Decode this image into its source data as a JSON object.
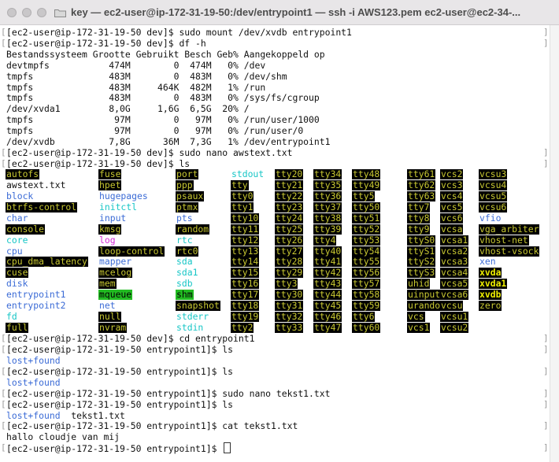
{
  "window": {
    "title": "key — ec2-user@ip-172-31-19-50:/dev/entrypoint1 — ssh -i AWS123.pem ec2-user@ec2-34-..."
  },
  "colors": {
    "dir_blue": "#3b6bd6",
    "cyan_link": "#17c6c6",
    "char_dev": "#c8c832",
    "char_dev_bg": "#000000",
    "block_dev": "#c8c832",
    "sticky_green_bg": "#22bb22",
    "magenta": "#d62ad6",
    "text": "#111111"
  },
  "lines_top": [
    "[ec2-user@ip-172-31-19-50 dev]$ sudo mount /dev/xvdb entrypoint1",
    "[ec2-user@ip-172-31-19-50 dev]$ df -h",
    "Bestandssysteem Grootte Gebruikt Besch Geb% Aangekoppeld op",
    "devtmpfs           474M        0  474M   0% /dev",
    "tmpfs              483M        0  483M   0% /dev/shm",
    "tmpfs              483M     464K  482M   1% /run",
    "tmpfs              483M        0  483M   0% /sys/fs/cgroup",
    "/dev/xvda1         8,0G     1,6G  6,5G  20% /",
    "tmpfs               97M        0   97M   0% /run/user/1000",
    "tmpfs               97M        0   97M   0% /run/user/0",
    "/dev/xvdb          7,8G      36M  7,3G   1% /dev/entrypoint1",
    "[ec2-user@ip-172-31-19-50 dev]$ sudo nano awstext.txt",
    "[ec2-user@ip-172-31-19-50 dev]$ ls"
  ],
  "ls_grid": [
    [
      {
        "t": "autofs",
        "s": "c"
      },
      {
        "t": "fuse",
        "s": "c"
      },
      {
        "t": "port",
        "s": "c"
      },
      {
        "t": "stdout",
        "s": "l"
      },
      {
        "t": "tty20",
        "s": "c"
      },
      {
        "t": "tty34",
        "s": "c"
      },
      {
        "t": "tty48",
        "s": "c"
      },
      {
        "t": "tty61",
        "s": "c"
      },
      {
        "t": "vcs2",
        "s": "c"
      },
      {
        "t": "vcsu3",
        "s": "c"
      }
    ],
    [
      {
        "t": "awstext.txt",
        "s": "p"
      },
      {
        "t": "hpet",
        "s": "c"
      },
      {
        "t": "ppp",
        "s": "c"
      },
      {
        "t": "tty",
        "s": "c"
      },
      {
        "t": "tty21",
        "s": "c"
      },
      {
        "t": "tty35",
        "s": "c"
      },
      {
        "t": "tty49",
        "s": "c"
      },
      {
        "t": "tty62",
        "s": "c"
      },
      {
        "t": "vcs3",
        "s": "c"
      },
      {
        "t": "vcsu4",
        "s": "c"
      }
    ],
    [
      {
        "t": "block",
        "s": "d"
      },
      {
        "t": "hugepages",
        "s": "d"
      },
      {
        "t": "psaux",
        "s": "c"
      },
      {
        "t": "tty0",
        "s": "c"
      },
      {
        "t": "tty22",
        "s": "c"
      },
      {
        "t": "tty36",
        "s": "c"
      },
      {
        "t": "tty5",
        "s": "c"
      },
      {
        "t": "tty63",
        "s": "c"
      },
      {
        "t": "vcs4",
        "s": "c"
      },
      {
        "t": "vcsu5",
        "s": "c"
      }
    ],
    [
      {
        "t": "btrfs-control",
        "s": "c"
      },
      {
        "t": "initctl",
        "s": "l"
      },
      {
        "t": "ptmx",
        "s": "c"
      },
      {
        "t": "tty1",
        "s": "c"
      },
      {
        "t": "tty23",
        "s": "c"
      },
      {
        "t": "tty37",
        "s": "c"
      },
      {
        "t": "tty50",
        "s": "c"
      },
      {
        "t": "tty7",
        "s": "c"
      },
      {
        "t": "vcs5",
        "s": "c"
      },
      {
        "t": "vcsu6",
        "s": "c"
      }
    ],
    [
      {
        "t": "char",
        "s": "d"
      },
      {
        "t": "input",
        "s": "d"
      },
      {
        "t": "pts",
        "s": "d"
      },
      {
        "t": "tty10",
        "s": "c"
      },
      {
        "t": "tty24",
        "s": "c"
      },
      {
        "t": "tty38",
        "s": "c"
      },
      {
        "t": "tty51",
        "s": "c"
      },
      {
        "t": "tty8",
        "s": "c"
      },
      {
        "t": "vcs6",
        "s": "c"
      },
      {
        "t": "vfio",
        "s": "d"
      }
    ],
    [
      {
        "t": "console",
        "s": "c"
      },
      {
        "t": "kmsg",
        "s": "c"
      },
      {
        "t": "random",
        "s": "c"
      },
      {
        "t": "tty11",
        "s": "c"
      },
      {
        "t": "tty25",
        "s": "c"
      },
      {
        "t": "tty39",
        "s": "c"
      },
      {
        "t": "tty52",
        "s": "c"
      },
      {
        "t": "tty9",
        "s": "c"
      },
      {
        "t": "vcsa",
        "s": "c"
      },
      {
        "t": "vga_arbiter",
        "s": "c"
      }
    ],
    [
      {
        "t": "core",
        "s": "l"
      },
      {
        "t": "log",
        "s": "m"
      },
      {
        "t": "rtc",
        "s": "l"
      },
      {
        "t": "tty12",
        "s": "c"
      },
      {
        "t": "tty26",
        "s": "c"
      },
      {
        "t": "tty4",
        "s": "c"
      },
      {
        "t": "tty53",
        "s": "c"
      },
      {
        "t": "ttyS0",
        "s": "c"
      },
      {
        "t": "vcsa1",
        "s": "c"
      },
      {
        "t": "vhost-net",
        "s": "c"
      }
    ],
    [
      {
        "t": "cpu",
        "s": "d"
      },
      {
        "t": "loop-control",
        "s": "c"
      },
      {
        "t": "rtc0",
        "s": "c"
      },
      {
        "t": "tty13",
        "s": "c"
      },
      {
        "t": "tty27",
        "s": "c"
      },
      {
        "t": "tty40",
        "s": "c"
      },
      {
        "t": "tty54",
        "s": "c"
      },
      {
        "t": "ttyS1",
        "s": "c"
      },
      {
        "t": "vcsa2",
        "s": "c"
      },
      {
        "t": "vhost-vsock",
        "s": "c"
      }
    ],
    [
      {
        "t": "cpu_dma_latency",
        "s": "c"
      },
      {
        "t": "mapper",
        "s": "d"
      },
      {
        "t": "sda",
        "s": "l"
      },
      {
        "t": "tty14",
        "s": "c"
      },
      {
        "t": "tty28",
        "s": "c"
      },
      {
        "t": "tty41",
        "s": "c"
      },
      {
        "t": "tty55",
        "s": "c"
      },
      {
        "t": "ttyS2",
        "s": "c"
      },
      {
        "t": "vcsa3",
        "s": "c"
      },
      {
        "t": "xen",
        "s": "d"
      }
    ],
    [
      {
        "t": "cuse",
        "s": "c"
      },
      {
        "t": "mcelog",
        "s": "c"
      },
      {
        "t": "sda1",
        "s": "l"
      },
      {
        "t": "tty15",
        "s": "c"
      },
      {
        "t": "tty29",
        "s": "c"
      },
      {
        "t": "tty42",
        "s": "c"
      },
      {
        "t": "tty56",
        "s": "c"
      },
      {
        "t": "ttyS3",
        "s": "c"
      },
      {
        "t": "vcsa4",
        "s": "c"
      },
      {
        "t": "xvda",
        "s": "b"
      }
    ],
    [
      {
        "t": "disk",
        "s": "d"
      },
      {
        "t": "mem",
        "s": "c"
      },
      {
        "t": "sdb",
        "s": "l"
      },
      {
        "t": "tty16",
        "s": "c"
      },
      {
        "t": "tty3",
        "s": "c"
      },
      {
        "t": "tty43",
        "s": "c"
      },
      {
        "t": "tty57",
        "s": "c"
      },
      {
        "t": "uhid",
        "s": "c"
      },
      {
        "t": "vcsa5",
        "s": "c"
      },
      {
        "t": "xvda1",
        "s": "b"
      }
    ],
    [
      {
        "t": "entrypoint1",
        "s": "d"
      },
      {
        "t": "mqueue",
        "s": "g"
      },
      {
        "t": "shm",
        "s": "g"
      },
      {
        "t": "tty17",
        "s": "c"
      },
      {
        "t": "tty30",
        "s": "c"
      },
      {
        "t": "tty44",
        "s": "c"
      },
      {
        "t": "tty58",
        "s": "c"
      },
      {
        "t": "uinput",
        "s": "c"
      },
      {
        "t": "vcsa6",
        "s": "c"
      },
      {
        "t": "xvdb",
        "s": "b"
      }
    ],
    [
      {
        "t": "entrypoint2",
        "s": "d"
      },
      {
        "t": "net",
        "s": "d"
      },
      {
        "t": "snapshot",
        "s": "c"
      },
      {
        "t": "tty18",
        "s": "c"
      },
      {
        "t": "tty31",
        "s": "c"
      },
      {
        "t": "tty45",
        "s": "c"
      },
      {
        "t": "tty59",
        "s": "c"
      },
      {
        "t": "urandom",
        "s": "c"
      },
      {
        "t": "vcsu",
        "s": "c"
      },
      {
        "t": "zero",
        "s": "c"
      }
    ],
    [
      {
        "t": "fd",
        "s": "l"
      },
      {
        "t": "null",
        "s": "c"
      },
      {
        "t": "stderr",
        "s": "l"
      },
      {
        "t": "tty19",
        "s": "c"
      },
      {
        "t": "tty32",
        "s": "c"
      },
      {
        "t": "tty46",
        "s": "c"
      },
      {
        "t": "tty6",
        "s": "c"
      },
      {
        "t": "vcs",
        "s": "c"
      },
      {
        "t": "vcsu1",
        "s": "c"
      },
      {
        "t": "",
        "s": "p"
      }
    ],
    [
      {
        "t": "full",
        "s": "c"
      },
      {
        "t": "nvram",
        "s": "c"
      },
      {
        "t": "stdin",
        "s": "l"
      },
      {
        "t": "tty2",
        "s": "c"
      },
      {
        "t": "tty33",
        "s": "c"
      },
      {
        "t": "tty47",
        "s": "c"
      },
      {
        "t": "tty60",
        "s": "c"
      },
      {
        "t": "vcs1",
        "s": "c"
      },
      {
        "t": "vcsu2",
        "s": "c"
      },
      {
        "t": "",
        "s": "p"
      }
    ]
  ],
  "lines_bottom": [
    {
      "parts": [
        {
          "t": "[ec2-user@ip-172-31-19-50 dev]$ cd entrypoint1",
          "s": "p"
        }
      ]
    },
    {
      "parts": [
        {
          "t": "[ec2-user@ip-172-31-19-50 entrypoint1]$ ls",
          "s": "p"
        }
      ]
    },
    {
      "parts": [
        {
          "t": "lost+found",
          "s": "d"
        }
      ]
    },
    {
      "parts": [
        {
          "t": "[ec2-user@ip-172-31-19-50 entrypoint1]$ ls",
          "s": "p"
        }
      ]
    },
    {
      "parts": [
        {
          "t": "lost+found",
          "s": "d"
        }
      ]
    },
    {
      "parts": [
        {
          "t": "[ec2-user@ip-172-31-19-50 entrypoint1]$ sudo nano tekst1.txt",
          "s": "p"
        }
      ]
    },
    {
      "parts": [
        {
          "t": "[ec2-user@ip-172-31-19-50 entrypoint1]$ ls",
          "s": "p"
        }
      ]
    },
    {
      "parts": [
        {
          "t": "lost+found",
          "s": "d"
        },
        {
          "t": "  tekst1.txt",
          "s": "p"
        }
      ]
    },
    {
      "parts": [
        {
          "t": "[ec2-user@ip-172-31-19-50 entrypoint1]$ cat tekst1.txt",
          "s": "p"
        }
      ]
    },
    {
      "parts": [
        {
          "t": "hallo cloudje van mij",
          "s": "p"
        }
      ]
    },
    {
      "parts": [
        {
          "t": "[ec2-user@ip-172-31-19-50 entrypoint1]$ ",
          "s": "p"
        }
      ],
      "cursor": true
    }
  ]
}
